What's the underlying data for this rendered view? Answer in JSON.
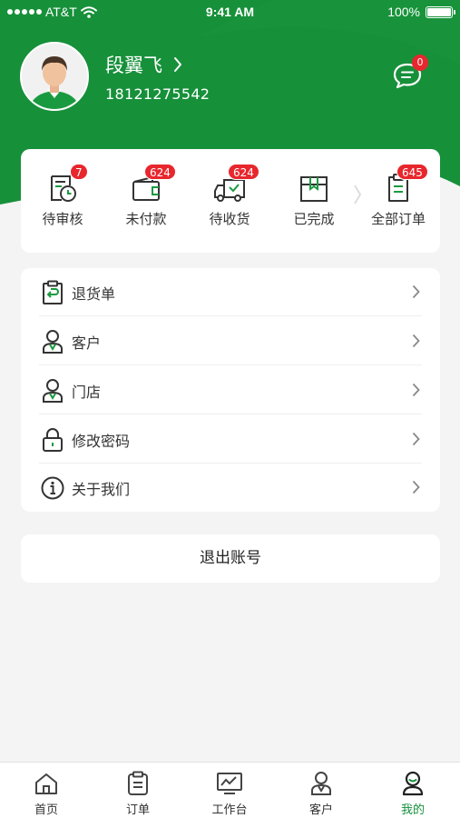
{
  "status_bar": {
    "carrier": "AT&T",
    "time": "9:41 AM",
    "battery": "100%"
  },
  "profile": {
    "name": "段翼飞",
    "phone": "18121275542"
  },
  "messages": {
    "badge": "0"
  },
  "orders": [
    {
      "label": "待审核",
      "badge": "7",
      "icon": "pending-review-icon"
    },
    {
      "label": "未付款",
      "badge": "624",
      "icon": "wallet-icon"
    },
    {
      "label": "待收货",
      "badge": "624",
      "icon": "delivery-truck-icon"
    },
    {
      "label": "已完成",
      "badge": "",
      "icon": "completed-box-icon"
    },
    {
      "label": "全部订单",
      "badge": "645",
      "icon": "all-orders-icon"
    }
  ],
  "menu": [
    {
      "label": "退货单",
      "icon": "return-clipboard-icon"
    },
    {
      "label": "客户",
      "icon": "customer-icon"
    },
    {
      "label": "门店",
      "icon": "store-person-icon"
    },
    {
      "label": "修改密码",
      "icon": "lock-icon"
    },
    {
      "label": "关于我们",
      "icon": "info-icon"
    }
  ],
  "logout_label": "退出账号",
  "tabs": [
    {
      "label": "首页",
      "icon": "home-icon"
    },
    {
      "label": "订单",
      "icon": "order-icon"
    },
    {
      "label": "工作台",
      "icon": "workbench-icon"
    },
    {
      "label": "客户",
      "icon": "customer-tab-icon"
    },
    {
      "label": "我的",
      "icon": "me-icon",
      "active": true
    }
  ],
  "colors": {
    "brand_green": "#15913b",
    "badge_red": "#e8262d",
    "background": "#f4f4f4"
  }
}
